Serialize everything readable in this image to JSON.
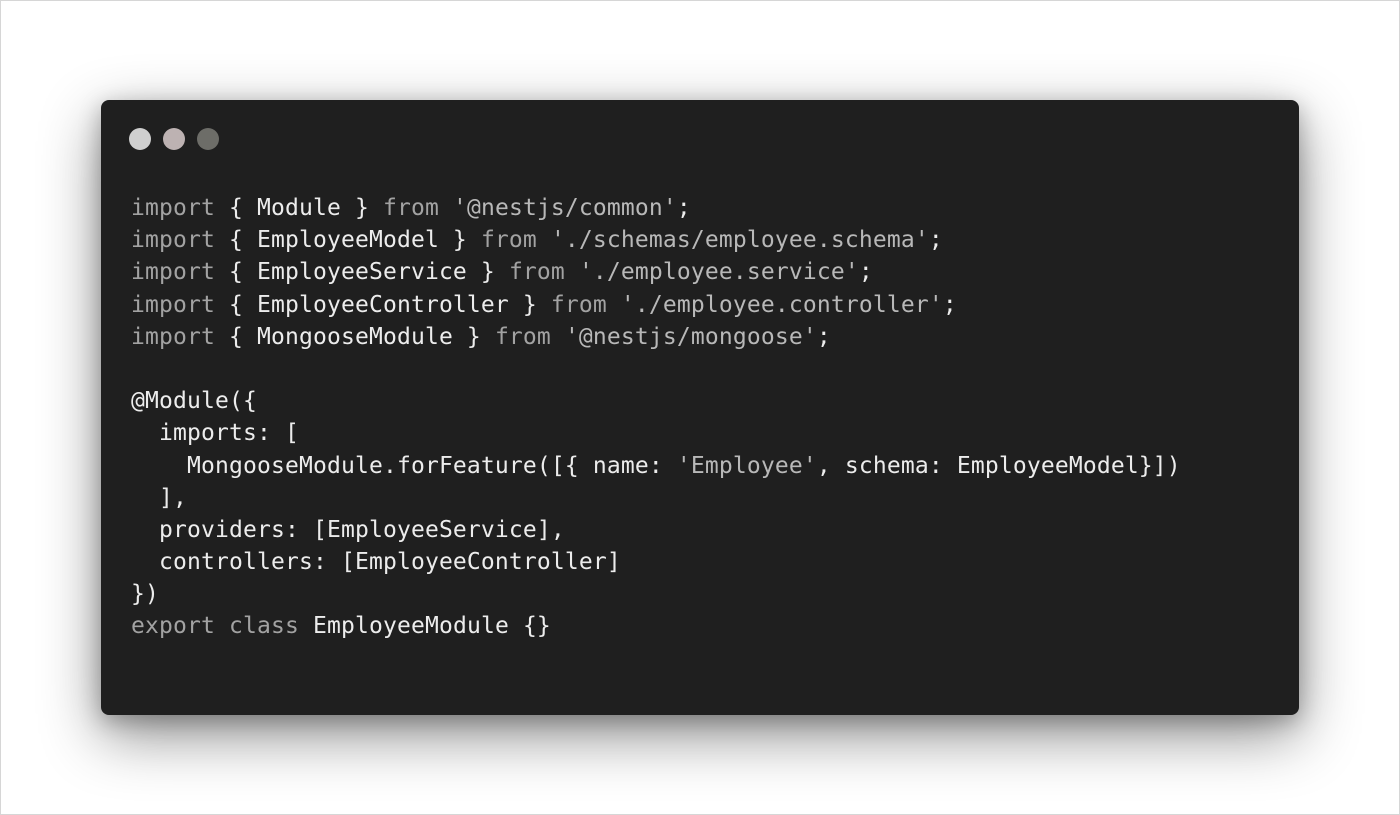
{
  "window": {
    "dots": [
      {
        "name": "close-dot",
        "color": "#cfcfcf"
      },
      {
        "name": "minimize-dot",
        "color": "#bdb2b2"
      },
      {
        "name": "zoom-dot",
        "color": "#6d6d68"
      }
    ],
    "background_color": "#1f1f1f"
  },
  "code": {
    "lines": [
      [
        {
          "t": "import",
          "k": "keyword"
        },
        {
          "t": " { Module } ",
          "k": "plain"
        },
        {
          "t": "from",
          "k": "keyword"
        },
        {
          "t": " ",
          "k": "plain"
        },
        {
          "t": "'@nestjs/common'",
          "k": "string"
        },
        {
          "t": ";",
          "k": "plain"
        }
      ],
      [
        {
          "t": "import",
          "k": "keyword"
        },
        {
          "t": " { EmployeeModel } ",
          "k": "plain"
        },
        {
          "t": "from",
          "k": "keyword"
        },
        {
          "t": " ",
          "k": "plain"
        },
        {
          "t": "'./schemas/employee.schema'",
          "k": "string"
        },
        {
          "t": ";",
          "k": "plain"
        }
      ],
      [
        {
          "t": "import",
          "k": "keyword"
        },
        {
          "t": " { EmployeeService } ",
          "k": "plain"
        },
        {
          "t": "from",
          "k": "keyword"
        },
        {
          "t": " ",
          "k": "plain"
        },
        {
          "t": "'./employee.service'",
          "k": "string"
        },
        {
          "t": ";",
          "k": "plain"
        }
      ],
      [
        {
          "t": "import",
          "k": "keyword"
        },
        {
          "t": " { EmployeeController } ",
          "k": "plain"
        },
        {
          "t": "from",
          "k": "keyword"
        },
        {
          "t": " ",
          "k": "plain"
        },
        {
          "t": "'./employee.controller'",
          "k": "string"
        },
        {
          "t": ";",
          "k": "plain"
        }
      ],
      [
        {
          "t": "import",
          "k": "keyword"
        },
        {
          "t": " { MongooseModule } ",
          "k": "plain"
        },
        {
          "t": "from",
          "k": "keyword"
        },
        {
          "t": " ",
          "k": "plain"
        },
        {
          "t": "'@nestjs/mongoose'",
          "k": "string"
        },
        {
          "t": ";",
          "k": "plain"
        }
      ],
      [],
      [
        {
          "t": "@Module({",
          "k": "plain"
        }
      ],
      [
        {
          "t": "  imports: [",
          "k": "plain"
        }
      ],
      [
        {
          "t": "    MongooseModule.forFeature([{ name: ",
          "k": "plain"
        },
        {
          "t": "'Employee'",
          "k": "string"
        },
        {
          "t": ", schema: EmployeeModel}])",
          "k": "plain"
        }
      ],
      [
        {
          "t": "  ],",
          "k": "plain"
        }
      ],
      [
        {
          "t": "  providers: [EmployeeService],",
          "k": "plain"
        }
      ],
      [
        {
          "t": "  controllers: [EmployeeController]",
          "k": "plain"
        }
      ],
      [
        {
          "t": "})",
          "k": "plain"
        }
      ],
      [
        {
          "t": "export",
          "k": "keyword"
        },
        {
          "t": " ",
          "k": "plain"
        },
        {
          "t": "class",
          "k": "keyword"
        },
        {
          "t": " EmployeeModule {}",
          "k": "plain"
        }
      ]
    ]
  }
}
